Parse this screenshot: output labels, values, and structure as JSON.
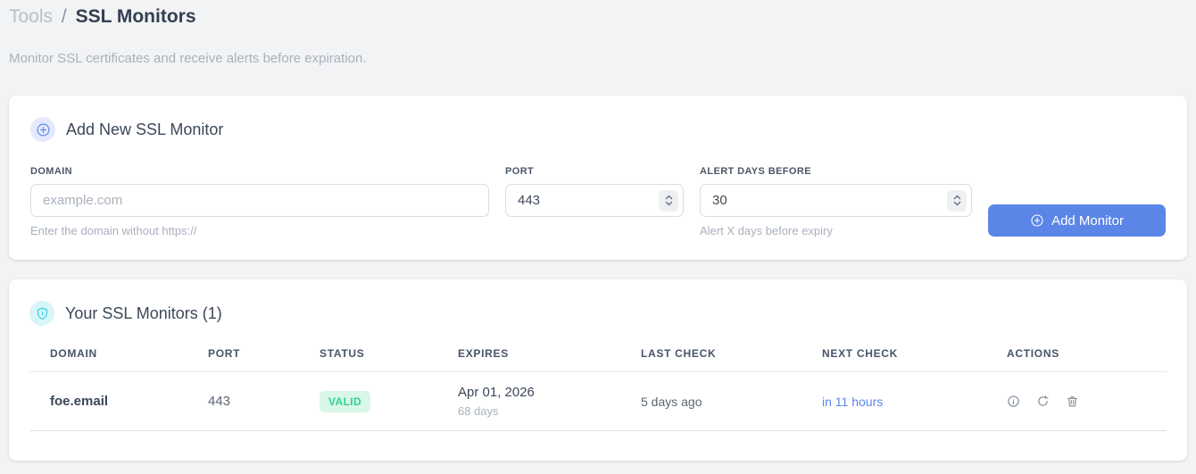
{
  "page": {
    "breadcrumb": {
      "parent": "Tools",
      "separator": "/",
      "current": "SSL Monitors"
    },
    "subtitle": "Monitor SSL certificates and receive alerts before expiration."
  },
  "add_monitor_card": {
    "title": "Add New SSL Monitor",
    "fields": {
      "domain": {
        "label": "DOMAIN",
        "placeholder": "example.com",
        "value": "",
        "helper": "Enter the domain without https://"
      },
      "port": {
        "label": "PORT",
        "value": "443"
      },
      "alert_days": {
        "label": "ALERT DAYS BEFORE",
        "value": "30",
        "helper": "Alert X days before expiry"
      }
    },
    "submit_label": "Add Monitor"
  },
  "monitors_card": {
    "title": "Your SSL Monitors (1)",
    "table": {
      "headers": [
        "DOMAIN",
        "PORT",
        "STATUS",
        "EXPIRES",
        "LAST CHECK",
        "NEXT CHECK",
        "ACTIONS"
      ],
      "rows": [
        {
          "domain": "foe.email",
          "port": "443",
          "status": "VALID",
          "expires_date": "Apr 01, 2026",
          "expires_in": "68 days",
          "last_check": "5 days ago",
          "next_check": "in 11 hours"
        }
      ]
    }
  },
  "icons": {
    "add_card": "plus-circle-icon",
    "monitors_card": "shield-lock-icon",
    "row_actions": [
      "info-icon",
      "refresh-icon",
      "trash-icon"
    ]
  },
  "colors": {
    "accent_blue": "#5b86e8",
    "valid_green_text": "#2fd18b",
    "valid_green_bg": "#d8f7e8",
    "cyan_icon": "#35d3e2",
    "page_bg": "#f2f3f4"
  }
}
